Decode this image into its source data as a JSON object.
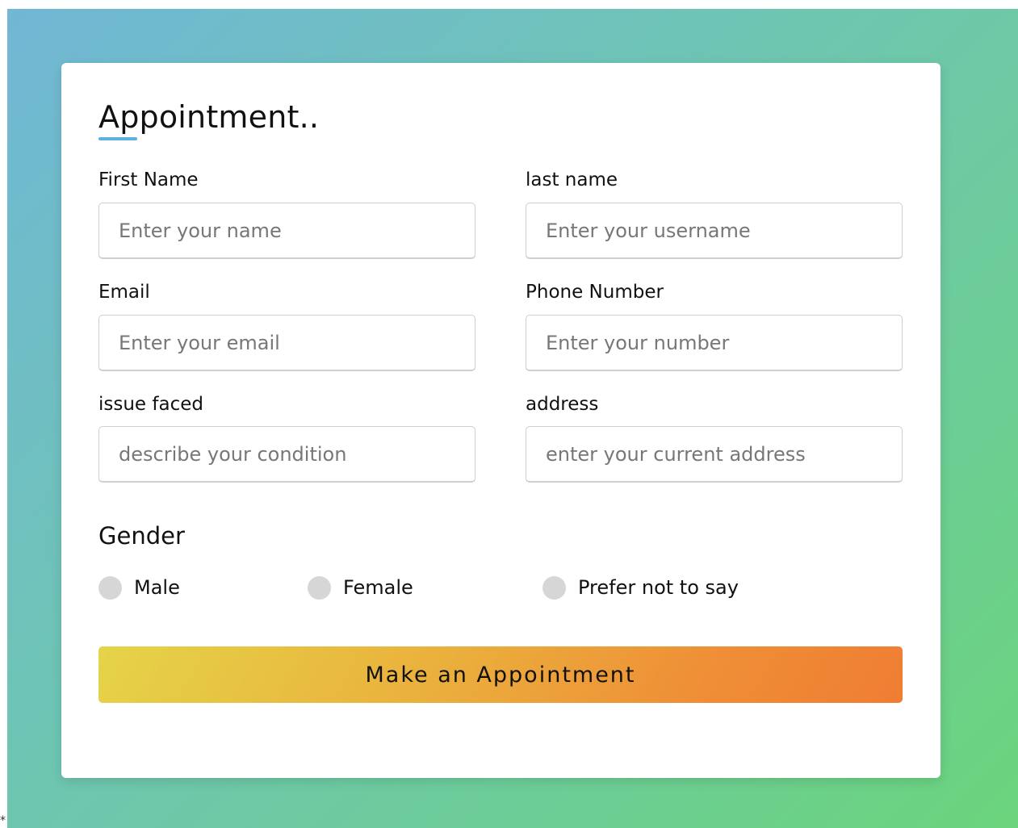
{
  "form": {
    "title": "Appointment..",
    "fields": {
      "first_name": {
        "label": "First Name",
        "placeholder": "Enter your name",
        "value": ""
      },
      "last_name": {
        "label": "last name",
        "placeholder": "Enter your username",
        "value": ""
      },
      "email": {
        "label": "Email",
        "placeholder": "Enter your email",
        "value": ""
      },
      "phone": {
        "label": "Phone Number",
        "placeholder": "Enter your number",
        "value": ""
      },
      "issue": {
        "label": "issue faced",
        "placeholder": "describe your condition",
        "value": ""
      },
      "address": {
        "label": "address",
        "placeholder": "enter your current address",
        "value": ""
      }
    },
    "gender": {
      "title": "Gender",
      "options": [
        "Male",
        "Female",
        "Prefer not to say"
      ],
      "selected": null
    },
    "submit_label": "Make an Appointment"
  },
  "page": {
    "corner_mark": "*"
  },
  "colors": {
    "background_gradient_start": "#71b7d6",
    "background_gradient_end": "#6bd47c",
    "title_underline": "#5eb0e0",
    "button_gradient_start": "#e5d449",
    "button_gradient_end": "#ef7d33",
    "radio_unselected": "#d6d6d6"
  }
}
